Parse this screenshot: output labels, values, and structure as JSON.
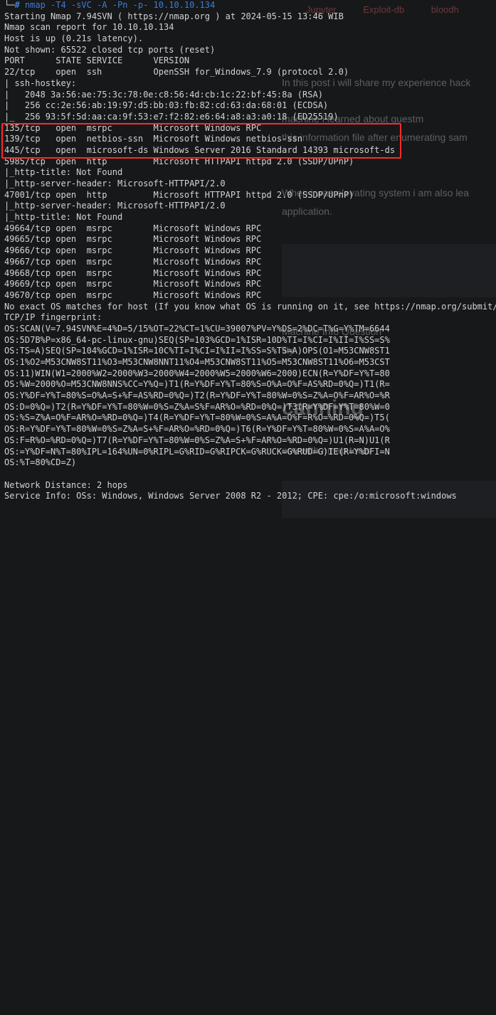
{
  "background": {
    "tabs": [
      "Jupyter",
      "Exploit-db",
      "bloodh"
    ],
    "lines": [
      "In this post i will share my experience hack",
      "           machine i learned about guestm",
      "this information file after enumerating sam",
      "When i was elevating system i am also lea",
      "application.",
      "Machine Info  Question",
      "                        lity",
      "                                one with nmap tools"
    ],
    "heading": "canning",
    "accent_color": "#5a5d62"
  },
  "terminal": {
    "prompt": {
      "corner": "└─",
      "symbol": "#",
      "command": "nmap -T4 -sVC -A -Pn -p- 10.10.10.134"
    },
    "lines": [
      "Starting Nmap 7.94SVN ( https://nmap.org ) at 2024-05-15 13:46 WIB",
      "Nmap scan report for 10.10.10.134",
      "Host is up (0.21s latency).",
      "Not shown: 65522 closed tcp ports (reset)",
      "PORT      STATE SERVICE      VERSION",
      "22/tcp    open  ssh          OpenSSH for_Windows_7.9 (protocol 2.0)",
      "| ssh-hostkey:",
      "|   2048 3a:56:ae:75:3c:78:0e:c8:56:4d:cb:1c:22:bf:45:8a (RSA)",
      "|   256 cc:2e:56:ab:19:97:d5:bb:03:fb:82:cd:63:da:68:01 (ECDSA)",
      "|_  256 93:5f:5d:aa:ca:9f:53:e7:f2:82:e6:64:a8:a3:a0:18 (ED25519)",
      "135/tcp   open  msrpc        Microsoft Windows RPC",
      "139/tcp   open  netbios-ssn  Microsoft Windows netbios-ssn",
      "445/tcp   open  microsoft-ds Windows Server 2016 Standard 14393 microsoft-ds",
      "5985/tcp  open  http         Microsoft HTTPAPI httpd 2.0 (SSDP/UPnP)",
      "|_http-title: Not Found",
      "|_http-server-header: Microsoft-HTTPAPI/2.0",
      "47001/tcp open  http         Microsoft HTTPAPI httpd 2.0 (SSDP/UPnP)",
      "|_http-server-header: Microsoft-HTTPAPI/2.0",
      "|_http-title: Not Found",
      "49664/tcp open  msrpc        Microsoft Windows RPC",
      "49665/tcp open  msrpc        Microsoft Windows RPC",
      "49666/tcp open  msrpc        Microsoft Windows RPC",
      "49667/tcp open  msrpc        Microsoft Windows RPC",
      "49668/tcp open  msrpc        Microsoft Windows RPC",
      "49669/tcp open  msrpc        Microsoft Windows RPC",
      "49670/tcp open  msrpc        Microsoft Windows RPC",
      "No exact OS matches for host (If you know what OS is running on it, see https://nmap.org/submit/ ).",
      "TCP/IP fingerprint:",
      "OS:SCAN(V=7.94SVN%E=4%D=5/15%OT=22%CT=1%CU=39007%PV=Y%DS=2%DC=T%G=Y%TM=6644",
      "OS:5D7B%P=x86_64-pc-linux-gnu)SEQ(SP=103%GCD=1%ISR=10D%TI=I%CI=I%II=I%SS=S%",
      "OS:TS=A)SEQ(SP=104%GCD=1%ISR=10C%TI=I%CI=I%II=I%SS=S%TS=A)OPS(O1=M53CNW8ST1",
      "OS:1%O2=M53CNW8ST11%O3=M53CNW8NNT11%O4=M53CNW8ST11%O5=M53CNW8ST11%O6=M53CST",
      "OS:11)WIN(W1=2000%W2=2000%W3=2000%W4=2000%W5=2000%W6=2000)ECN(R=Y%DF=Y%T=80",
      "OS:%W=2000%O=M53CNW8NNS%CC=Y%Q=)T1(R=Y%DF=Y%T=80%S=O%A=O%F=AS%RD=0%Q=)T1(R=",
      "OS:Y%DF=Y%T=80%S=O%A=S+%F=AS%RD=0%Q=)T2(R=Y%DF=Y%T=80%W=0%S=Z%A=O%F=AR%O=%R",
      "OS:D=0%Q=)T2(R=Y%DF=Y%T=80%W=0%S=Z%A=S%F=AR%O=%RD=0%Q=)T3(R=Y%DF=Y%T=80%W=0",
      "OS:%S=Z%A=O%F=AR%O=%RD=0%Q=)T4(R=Y%DF=Y%T=80%W=0%S=A%A=O%F=R%O=%RD=0%Q=)T5(",
      "OS:R=Y%DF=Y%T=80%W=0%S=Z%A=S+%F=AR%O=%RD=0%Q=)T6(R=Y%DF=Y%T=80%W=0%S=A%A=O%",
      "OS:F=R%O=%RD=0%Q=)T7(R=Y%DF=Y%T=80%W=0%S=Z%A=S+%F=AR%O=%RD=0%Q=)U1(R=N)U1(R",
      "OS:=Y%DF=N%T=80%IPL=164%UN=0%RIPL=G%RID=G%RIPCK=G%RUCK=G%RUD=G)IE(R=Y%DFI=N",
      "OS:%T=80%CD=Z)",
      "",
      "Network Distance: 2 hops",
      "Service Info: OSs: Windows, Windows Server 2008 R2 - 2012; CPE: cpe:/o:microsoft:windows"
    ],
    "highlight_color": "#ff2a2a",
    "text_color": "#d3d3d3",
    "prompt_color": "#3b7dd8"
  }
}
